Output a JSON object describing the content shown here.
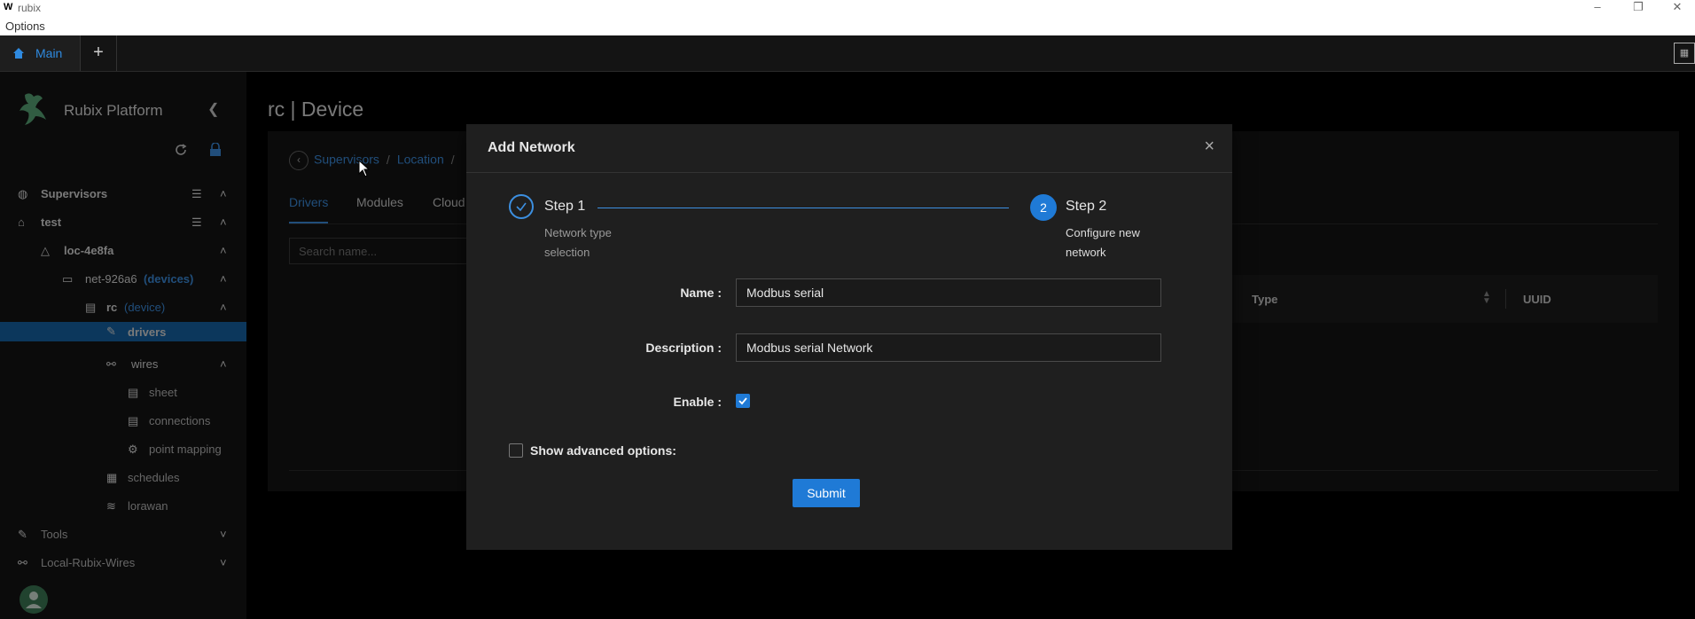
{
  "window": {
    "title": "rubix",
    "menu_options": "Options"
  },
  "tabbar": {
    "main_tab": "Main",
    "add_tab": "+"
  },
  "sidebar": {
    "brand": "Rubix Platform",
    "tree": [
      {
        "label": "Supervisors"
      },
      {
        "label": "test"
      },
      {
        "label": "loc-4e8fa"
      },
      {
        "label": "net-926a6",
        "tag": "(devices)"
      },
      {
        "label": "rc",
        "tag": "(device)"
      },
      {
        "label": "drivers"
      },
      {
        "label": "wires"
      },
      {
        "label": "sheet"
      },
      {
        "label": "connections"
      },
      {
        "label": "point mapping"
      },
      {
        "label": "schedules"
      },
      {
        "label": "lorawan"
      },
      {
        "label": "Tools"
      },
      {
        "label": "Local-Rubix-Wires"
      }
    ]
  },
  "page": {
    "title": "rc | Device",
    "breadcrumb": {
      "item1": "Supervisors",
      "sep1": "/",
      "item2": "Location",
      "sep2": "/"
    },
    "tabs": [
      "Drivers",
      "Modules",
      "Cloud"
    ],
    "search_placeholder": "Search name...",
    "table": {
      "col_type": "Type",
      "col_uuid": "UUID"
    }
  },
  "modal": {
    "title": "Add Network",
    "close": "×",
    "steps": [
      {
        "title": "Step 1",
        "desc_line1": "Network type",
        "desc_line2": "selection",
        "status": "done"
      },
      {
        "number": "2",
        "title": "Step 2",
        "desc_line1": "Configure new",
        "desc_line2": "network",
        "status": "active"
      }
    ],
    "fields": {
      "name_label": "Name :",
      "name_value": "Modbus serial",
      "description_label": "Description :",
      "description_value": "Modbus serial Network",
      "enable_label": "Enable :",
      "enable_checked": true
    },
    "advanced_label": "Show advanced options:",
    "advanced_checked": false,
    "submit_label": "Submit"
  },
  "colors": {
    "accent": "#1f7ad6",
    "link": "#3c8fe0",
    "sidebar_active": "#1765a8"
  }
}
